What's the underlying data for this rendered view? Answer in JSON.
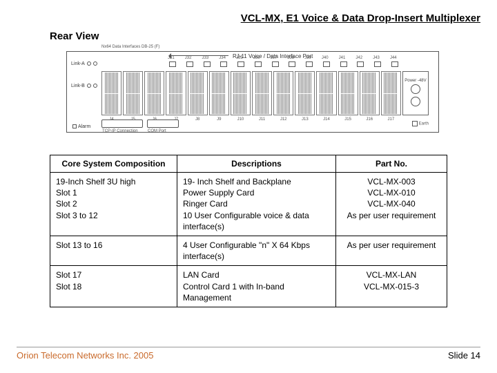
{
  "header": {
    "title": "VCL-MX, E1 Voice & Data Drop-Insert Multiplexer"
  },
  "section": {
    "title": "Rear View"
  },
  "diagram": {
    "top_label": "RJ-11 Voice / Data Interface Port",
    "top_right_label": "Power -48V",
    "link_a": "Link-A",
    "link_b": "Link-B",
    "alarm": "Alarm",
    "bottom_interfaces": "Nx64 Data Interfaces DB-25 (F)",
    "tcp_ip": "TCP-IP Connection",
    "com_port": "COM Port",
    "earth": "Earth",
    "rj_labels": [
      "J31",
      "J32",
      "J33",
      "J34",
      "J35",
      "J36",
      "J37",
      "J38",
      "J39",
      "J40",
      "J41",
      "J42",
      "J43",
      "J44"
    ],
    "slot_labels": [
      "J4",
      "J5",
      "J6",
      "J7",
      "J8",
      "J9",
      "J10",
      "J11",
      "J12",
      "J13",
      "J14",
      "J15",
      "J16",
      "J17"
    ]
  },
  "table": {
    "headers": {
      "col1": "Core System Composition",
      "col2": "Descriptions",
      "col3": "Part No."
    },
    "rows": [
      {
        "comp": "19-Inch Shelf 3U high\nSlot 1\nSlot 2\nSlot 3 to 12",
        "desc": "19- Inch Shelf  and Backplane\nPower Supply Card\nRinger Card\n10 User Configurable voice & data interface(s)",
        "part": "VCL-MX-003\nVCL-MX-010\nVCL-MX-040\nAs per user requirement"
      },
      {
        "comp": "Slot 13 to 16",
        "desc": "4 User Configurable \"n\" X 64 Kbps interface(s)",
        "part": "As per user requirement"
      },
      {
        "comp": "Slot 17\nSlot 18",
        "desc": "LAN Card\nControl Card 1 with In-band Management",
        "part": "VCL-MX-LAN\nVCL-MX-015-3"
      }
    ]
  },
  "footer": {
    "company": "Orion Telecom Networks Inc. 2005",
    "slide": "Slide 14"
  }
}
